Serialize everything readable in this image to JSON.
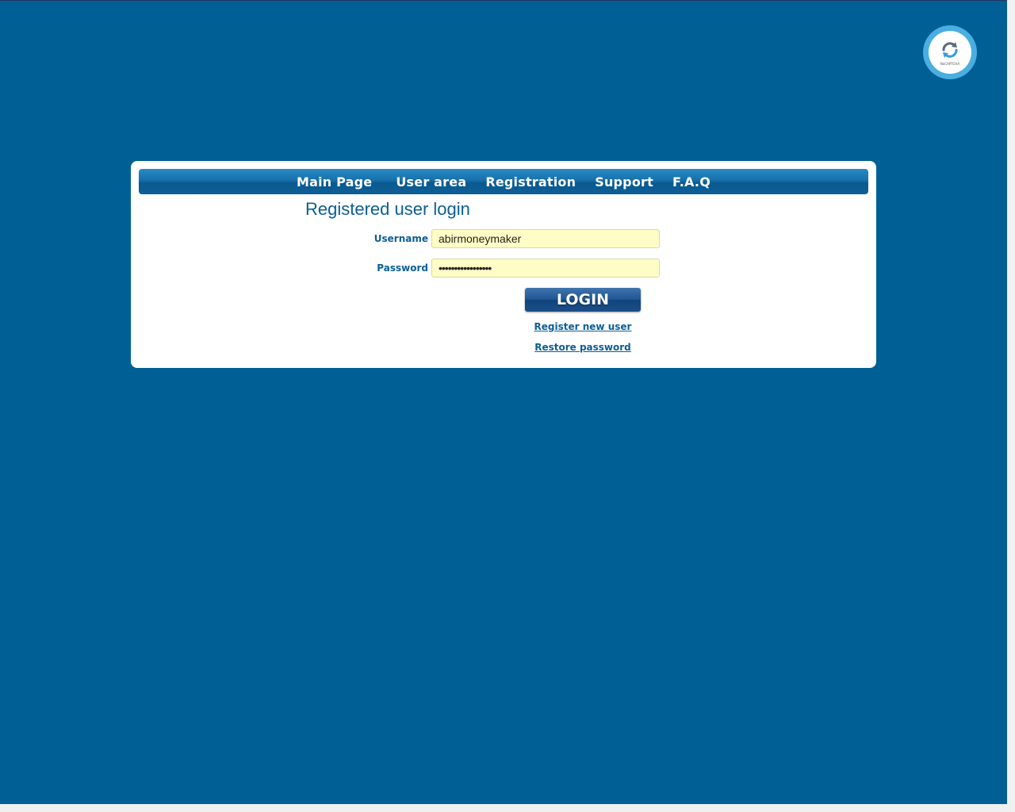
{
  "captcha": {
    "brand_label": "NoCAPTCHA"
  },
  "nav": {
    "items": [
      {
        "label": "Main Page"
      },
      {
        "label": "User area"
      },
      {
        "label": "Registration"
      },
      {
        "label": "Support"
      },
      {
        "label": "F.A.Q"
      }
    ]
  },
  "login": {
    "title": "Registered user login",
    "username_label": "Username",
    "username_value": "abirmoneymaker",
    "password_label": "Password",
    "password_value": "•••••••••••••••••",
    "submit_label": "LOGIN",
    "register_link": "Register new user",
    "restore_link": "Restore password"
  },
  "colors": {
    "page_background": "#006096",
    "accent_text": "#0b5e95",
    "input_background": "#fefdc5"
  }
}
